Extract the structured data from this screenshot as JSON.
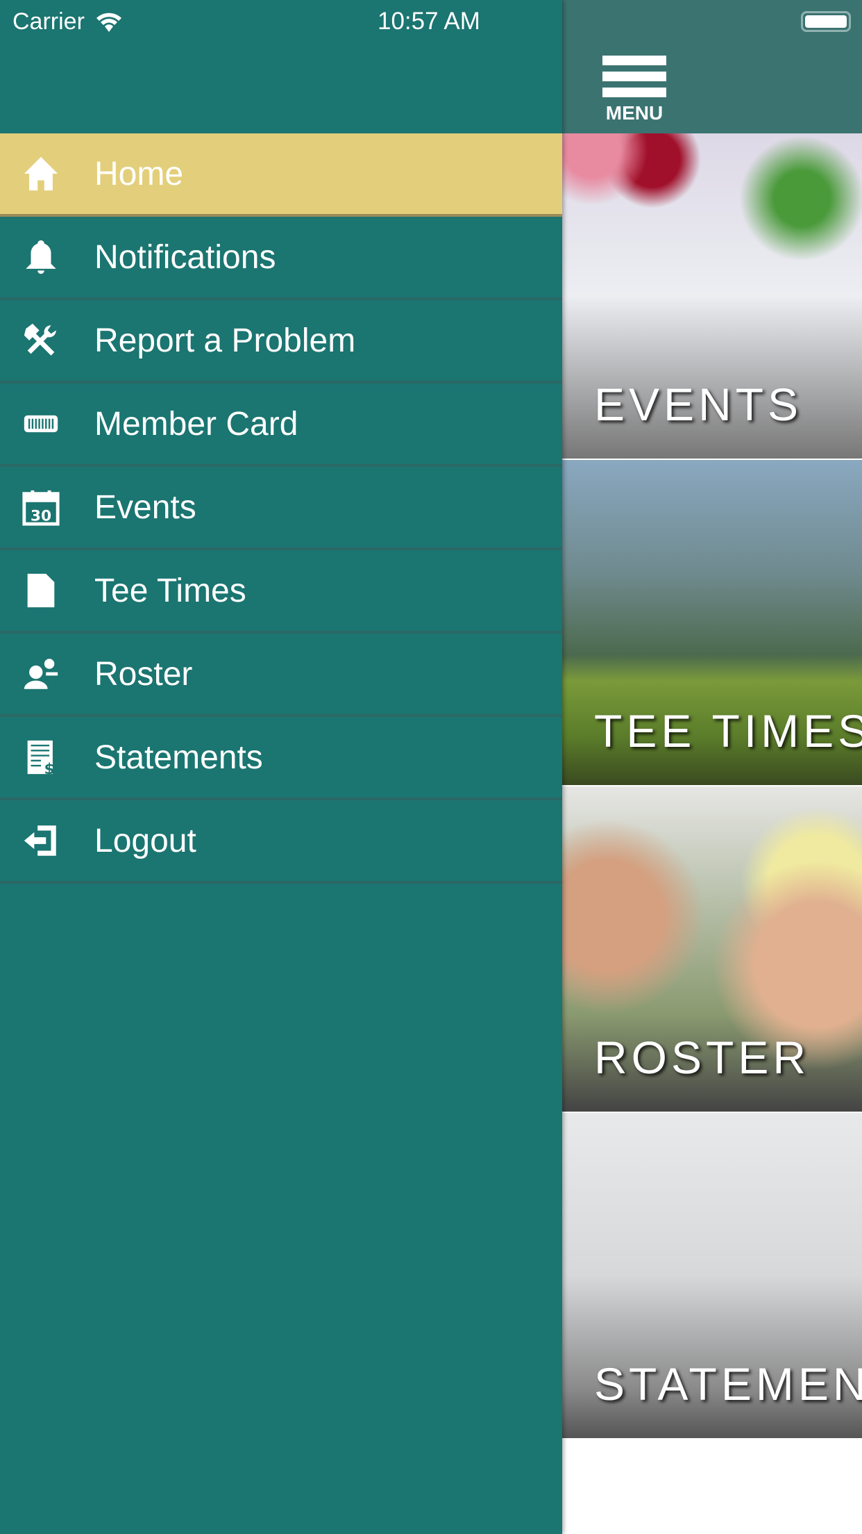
{
  "status_bar": {
    "carrier": "Carrier",
    "time": "10:57 AM"
  },
  "header": {
    "menu_label": "MENU"
  },
  "drawer": {
    "items": [
      {
        "label": "Home",
        "icon": "home-icon",
        "active": true
      },
      {
        "label": "Notifications",
        "icon": "bell-icon"
      },
      {
        "label": "Report a Problem",
        "icon": "tools-icon"
      },
      {
        "label": "Member Card",
        "icon": "barcode-card-icon"
      },
      {
        "label": "Events",
        "icon": "calendar-icon"
      },
      {
        "label": "Tee Times",
        "icon": "document-icon"
      },
      {
        "label": "Roster",
        "icon": "people-icon"
      },
      {
        "label": "Statements",
        "icon": "statement-icon"
      },
      {
        "label": "Logout",
        "icon": "logout-icon"
      }
    ]
  },
  "tiles": [
    {
      "label": "EVENTS"
    },
    {
      "label": "TEE TIMES"
    },
    {
      "label": "ROSTER"
    },
    {
      "label": "STATEMENTS"
    }
  ],
  "colors": {
    "drawer": "#1b7571",
    "active": "#e3cf7b",
    "topbar": "#3b7371"
  }
}
